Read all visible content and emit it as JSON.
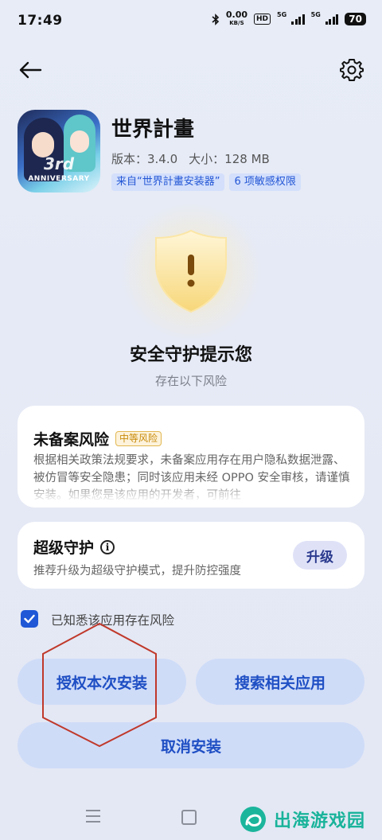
{
  "status_bar": {
    "time": "17:49",
    "net_speed_value": "0.00",
    "net_speed_unit": "KB/S",
    "hd_label": "HD",
    "sim1_label": "5G",
    "sim2_label": "5G",
    "battery": "70"
  },
  "header": {
    "back_icon": "arrow-left-icon",
    "settings_icon": "gear-icon"
  },
  "app": {
    "name": "世界計畫",
    "version": "版本：3.4.0",
    "size": "大小：128 MB",
    "tags": [
      "来自“世界計畫安装器”",
      "6 项敏感权限"
    ],
    "icon_anniversary_text": "ANNIVERSARY",
    "icon_number_text": "3rd"
  },
  "warning": {
    "title": "安全守护提示您",
    "subtitle": "存在以下风险",
    "shield_mark": "!"
  },
  "risk_card": {
    "title": "未备案风险",
    "badge": "中等风险",
    "description": "根据相关政策法规要求，未备案应用存在用户隐私数据泄露、被仿冒等安全隐患；同时该应用未经 OPPO 安全审核，请谨慎安装。如果您是该应用的开发者，可前往"
  },
  "guard_card": {
    "title": "超级守护",
    "info_icon": "i",
    "description": "推荐升级为超级守护模式，提升防控强度",
    "upgrade_button": "升级"
  },
  "acknowledge": {
    "checked": true,
    "label": "已知悉该应用存在风险"
  },
  "buttons": {
    "authorize": "授权本次安装",
    "search": "搜索相关应用",
    "cancel": "取消安装"
  },
  "watermark": {
    "text": "出海游戏园"
  },
  "colors": {
    "accent": "#1f57d6",
    "button_bg": "#cfdcf8",
    "button_text": "#1f4fc4",
    "badge_text": "#c88a0a",
    "annotation": "#c0392b",
    "watermark": "#18b39a"
  }
}
